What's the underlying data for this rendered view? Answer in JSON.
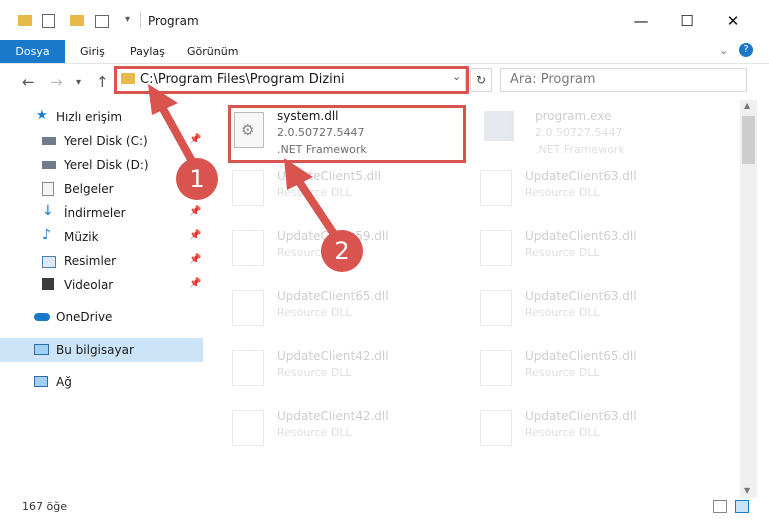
{
  "window": {
    "title": "Program",
    "minimize": "—",
    "maximize": "☐",
    "close": "✕"
  },
  "ribbon": {
    "tabs": [
      "Dosya",
      "Giriş",
      "Paylaş",
      "Görünüm"
    ]
  },
  "address": {
    "path": "C:\\Program Files\\Program Dizini",
    "search_placeholder": "Ara: Program"
  },
  "sidebar": {
    "items": [
      {
        "label": "Hızlı erişim",
        "icon": "star-icon",
        "pinned": false
      },
      {
        "label": "Yerel Disk (C:)",
        "icon": "drive-icon",
        "pinned": true
      },
      {
        "label": "Yerel Disk (D:)",
        "icon": "drive-icon",
        "pinned": false
      },
      {
        "label": "Belgeler",
        "icon": "documents-icon",
        "pinned": true
      },
      {
        "label": "İndirmeler",
        "icon": "downloads-icon",
        "pinned": true
      },
      {
        "label": "Müzik",
        "icon": "music-icon",
        "pinned": true
      },
      {
        "label": "Resimler",
        "icon": "pictures-icon",
        "pinned": true
      },
      {
        "label": "Videolar",
        "icon": "videos-icon",
        "pinned": true
      },
      {
        "label": "OneDrive",
        "icon": "cloud-icon",
        "pinned": false
      },
      {
        "label": "Bu bilgisayar",
        "icon": "computer-icon",
        "pinned": false
      },
      {
        "label": "Ağ",
        "icon": "network-icon",
        "pinned": false
      }
    ]
  },
  "files": {
    "highlighted": {
      "name": "system.dll",
      "version": "2.0.50727.5447",
      "desc": ".NET Framework"
    },
    "program": {
      "name": "program.exe",
      "version": "2.0.50727.5447",
      "desc": ".NET Framework"
    },
    "left_column": [
      {
        "name": "UpdateClient5.dll",
        "desc": "Resource DLL"
      },
      {
        "name": "UpdateClient59.dll",
        "desc": "Resource DLL"
      },
      {
        "name": "UpdateClient65.dll",
        "desc": "Resource DLL"
      },
      {
        "name": "UpdateClient42.dll",
        "desc": "Resource DLL"
      },
      {
        "name": "UpdateClient42.dll",
        "desc": "Resource DLL"
      }
    ],
    "right_column": [
      {
        "name": "UpdateClient63.dll",
        "desc": "Resource DLL"
      },
      {
        "name": "UpdateClient63.dll",
        "desc": "Resource DLL"
      },
      {
        "name": "UpdateClient63.dll",
        "desc": "Resource DLL"
      },
      {
        "name": "UpdateClient65.dll",
        "desc": "Resource DLL"
      },
      {
        "name": "UpdateClient63.dll",
        "desc": "Resource DLL"
      }
    ]
  },
  "annotations": {
    "step1": "1",
    "step2": "2"
  },
  "status": {
    "count": "167 öğe"
  },
  "colors": {
    "accent": "#1979ca",
    "highlight": "#d9534f",
    "selected": "#cce4f7"
  }
}
